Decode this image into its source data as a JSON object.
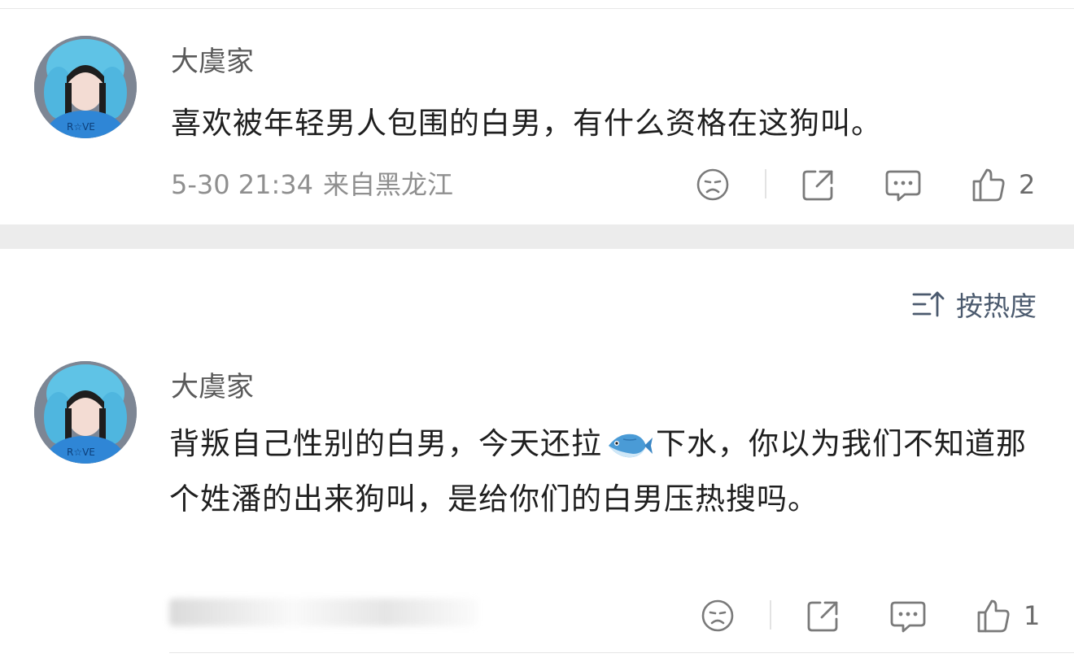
{
  "comments": [
    {
      "username": "大虞家",
      "text": "喜欢被年轻男人包围的白男，有什么资格在这狗叫。",
      "timestamp": "5-30 21:34",
      "location": "来自黑龙江",
      "likes": "2",
      "icons": [
        "dislike-face-icon",
        "share-icon",
        "comment-icon",
        "thumbs-up-icon"
      ]
    },
    {
      "username": "大虞家",
      "text_before_emoji": "背叛自己性别的白男，今天还拉",
      "emoji": "fish-emoji",
      "text_after_emoji": "下水，你以为我们不知道那个姓潘的出来狗叫，是给你们的白男压热搜吗。",
      "meta_blurred": true,
      "likes": "1",
      "icons": [
        "dislike-face-icon",
        "share-icon",
        "comment-icon",
        "thumbs-up-icon"
      ]
    }
  ],
  "sort": {
    "label": "按热度",
    "icon": "sort-icon"
  },
  "colors": {
    "text_primary": "#1f1f1f",
    "text_secondary": "#8f8f8f",
    "sort_color": "#4b5a6e",
    "separator": "#ececec"
  }
}
